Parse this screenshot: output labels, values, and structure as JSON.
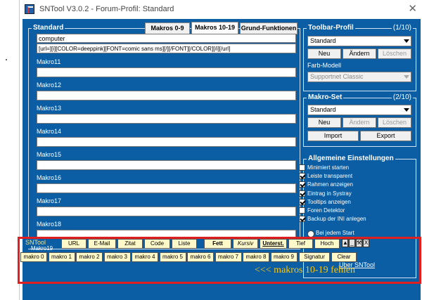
{
  "window": {
    "title": "SNTool V3.0.2 - Forum-Profil: Standard"
  },
  "colors": {
    "client_bg": "#0b5ea3",
    "toolbar_btn": "#fff8c8",
    "highlight": "#e02020",
    "annotation": "#f5c518"
  },
  "standard": {
    "legend": "Standard",
    "tabs": [
      "Makros 0-9",
      "Makros 10-19",
      "Grund-Funktionen"
    ],
    "active_tab": "Makros 10-19",
    "first_label": "computer",
    "first_value": "[url=][i][COLOR=deeppink][FONT=comic sans ms][/][/FONT][/COLOR][/i][/url]",
    "macros": [
      "Makro11",
      "Makro12",
      "Makro13",
      "Makro14",
      "Makro15",
      "Makro16",
      "Makro17",
      "Makro18",
      "Makro19"
    ]
  },
  "toolbar_profile": {
    "legend": "Toolbar-Profil",
    "count": "(1/10)",
    "selected": "Standard",
    "buttons": [
      "Neu",
      "Ändern",
      "Löschen"
    ],
    "color_model_label": "Farb-Modell",
    "color_model": "Supportnet Classic"
  },
  "macro_set": {
    "legend": "Makro-Set",
    "count": "(2/10)",
    "selected": "Standard",
    "buttons": [
      "Neu",
      "Ändern",
      "Löschen"
    ],
    "io_buttons": [
      "Import",
      "Export"
    ]
  },
  "settings": {
    "legend": "Allgemeine Einstellungen",
    "items": [
      {
        "label": "Minimiert starten",
        "checked": false
      },
      {
        "label": "Leiste transparent",
        "checked": true
      },
      {
        "label": "Rahmen anzeigen",
        "checked": true
      },
      {
        "label": "Eintrag in Systray",
        "checked": true
      },
      {
        "label": "Tooltips anzeigen",
        "checked": true
      },
      {
        "label": "Foren Detektor",
        "checked": false
      },
      {
        "label": "Backup der INI anlegen",
        "checked": true
      }
    ],
    "radio": "Bei jedem Start",
    "about_link": "Über SNTool"
  },
  "floating_toolbar": {
    "name": "SNTool",
    "buttons": [
      "URL",
      "E-Mail",
      "Zitat",
      "Code",
      "Liste",
      "Fett",
      "Kursiv",
      "Unterst.",
      "Tief",
      "Hoch"
    ],
    "mini": [
      "_",
      "X"
    ],
    "macros": [
      "makro 0",
      "makro 1",
      "makro 2",
      "makro 3",
      "makro 4",
      "makro 5",
      "makro 6",
      "makro 7",
      "makro 8",
      "makro 9"
    ],
    "extra": [
      "Signatur",
      "Clear"
    ]
  },
  "annotation": "<<< makros 10-19 fehlen"
}
